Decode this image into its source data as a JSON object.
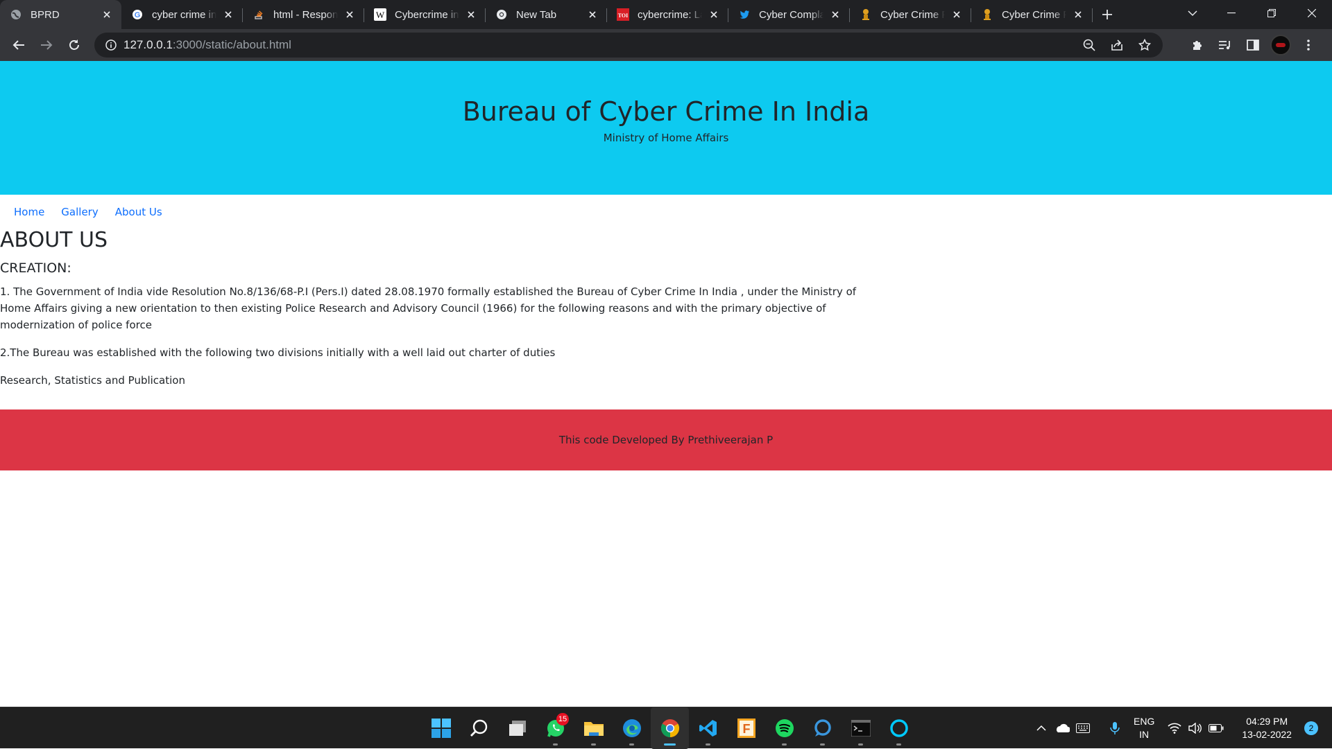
{
  "browser": {
    "tabs": [
      {
        "title": "BPRD",
        "active": true,
        "favicon": "globe-icon"
      },
      {
        "title": "cyber crime in",
        "favicon": "google-icon"
      },
      {
        "title": "html - Respon",
        "favicon": "stackoverflow-icon"
      },
      {
        "title": "Cybercrime in",
        "favicon": "wikipedia-icon"
      },
      {
        "title": "New Tab",
        "favicon": "chrome-icon"
      },
      {
        "title": "cybercrime: La",
        "favicon": "toi-icon"
      },
      {
        "title": "Cyber Compla",
        "favicon": "twitter-icon"
      },
      {
        "title": "Cyber Crime P",
        "favicon": "emblem-icon"
      },
      {
        "title": "Cyber Crime P",
        "favicon": "emblem-icon"
      }
    ],
    "url_host": "127.0.0.1",
    "url_rest": ":3000/static/about.html",
    "accent": "#8ab4f8"
  },
  "site": {
    "title": "Bureau of Cyber Crime In India",
    "subtitle": "Ministry of Home Affairs",
    "header_color": "#0dcaf0",
    "nav": [
      "Home",
      "Gallery",
      "About Us"
    ],
    "heading": "ABOUT US",
    "subheading": "CREATION:",
    "paragraphs": [
      "1. The Government of India vide Resolution No.8/136/68-P.I (Pers.I) dated 28.08.1970 formally established the Bureau of Cyber Crime In India , under the Ministry of Home Affairs giving a new orientation to then existing Police Research and Advisory Council (1966) for the following reasons and with the primary objective of modernization of police force",
      "2.The Bureau was established with the following two divisions initially with a well laid out charter of duties",
      "Research, Statistics and Publication"
    ],
    "footer": "This code Developed By Prethiveerajan P",
    "footer_color": "#dc3545"
  },
  "taskbar": {
    "apps": [
      "windows-start-icon",
      "search-icon",
      "task-view-icon",
      "whatsapp-icon",
      "file-explorer-icon",
      "edge-icon",
      "chrome-icon",
      "vscode-icon",
      "figma-icon",
      "spotify-icon",
      "cortana-icon",
      "terminal-icon",
      "alexa-icon"
    ],
    "whatsapp_badge": "15",
    "lang_top": "ENG",
    "lang_bottom": "IN",
    "time": "04:29 PM",
    "date": "13-02-2022",
    "notifications": "2"
  }
}
